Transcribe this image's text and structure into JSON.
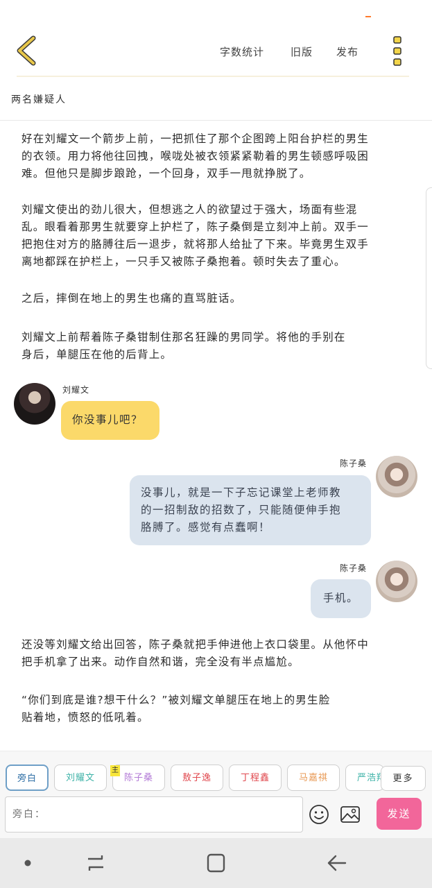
{
  "header": {
    "menu": [
      "字数统计",
      "旧版",
      "发布"
    ]
  },
  "title": "两名嫌疑人",
  "narration": [
    "好在刘耀文一个箭步上前，一把抓住了那个企图跨上阳台护栏的男生\n的衣领。用力将他往回拽，喉咙处被衣领紧紧勒着的男生顿感呼吸困\n难。但他只是脚步踉跄，一个回身，双手一甩就挣脱了。",
    "刘耀文使出的劲儿很大，但想逃之人的欲望过于强大，场面有些混\n乱。眼看着那男生就要穿上护栏了，陈子桑倒是立刻冲上前。双手一\n把抱住对方的胳膊往后一退步，就将那人给扯了下来。毕竟男生双手\n离地都踩在护栏上，一只手又被陈子桑抱着。顿时失去了重心。",
    "之后，摔倒在地上的男生也痛的直骂脏话。",
    "刘耀文上前帮着陈子桑钳制住那名狂躁的男同学。将他的手别在\n身后，单腿压在他的后背上。"
  ],
  "messages": [
    {
      "speaker": "刘耀文",
      "text": "你没事儿吧？",
      "side": "left"
    },
    {
      "speaker": "陈子桑",
      "text": "没事儿，就是一下子忘记课堂上老师教\n的一招制敌的招数了，只能随便伸手抱\n胳膊了。感觉有点蠢啊！",
      "side": "right"
    },
    {
      "speaker": "陈子桑",
      "text": "手机。",
      "side": "right"
    }
  ],
  "narration_after": [
    "还没等刘耀文给出回答，陈子桑就把手伸进他上衣口袋里。从他怀中\n把手机拿了出来。动作自然和谐，完全没有半点尴尬。",
    "“你们到底是谁?想干什么？”被刘耀文单腿压在地上的男生脸\n贴着地，愤怒的低吼着。"
  ],
  "characters": [
    {
      "name": "旁白",
      "color": "#2f6fa6",
      "active": true
    },
    {
      "name": "刘耀文",
      "color": "#3fb3a8",
      "active": false
    },
    {
      "name": "陈子桑",
      "color": "#b37bd6",
      "active": false,
      "badge": "主"
    },
    {
      "name": "敖子逸",
      "color": "#e0484e",
      "active": false
    },
    {
      "name": "丁程鑫",
      "color": "#e0484e",
      "active": false
    },
    {
      "name": "马嘉祺",
      "color": "#e89a56",
      "active": false
    },
    {
      "name": "严浩翔",
      "color": "#3fb3a8",
      "active": false
    }
  ],
  "more_label": "更多",
  "input": {
    "placeholder": "旁白："
  },
  "send_label": "发送",
  "icons": [
    "back-arrow-icon",
    "more-dots-icon",
    "emoji-icon",
    "image-icon",
    "recent-apps-icon",
    "home-icon",
    "back-icon"
  ],
  "colors": {
    "accent": "#f2669a",
    "yellow": "#fbd96a",
    "bubble_blue": "#dbe4ee",
    "back_arrow": "#e8c74a"
  }
}
